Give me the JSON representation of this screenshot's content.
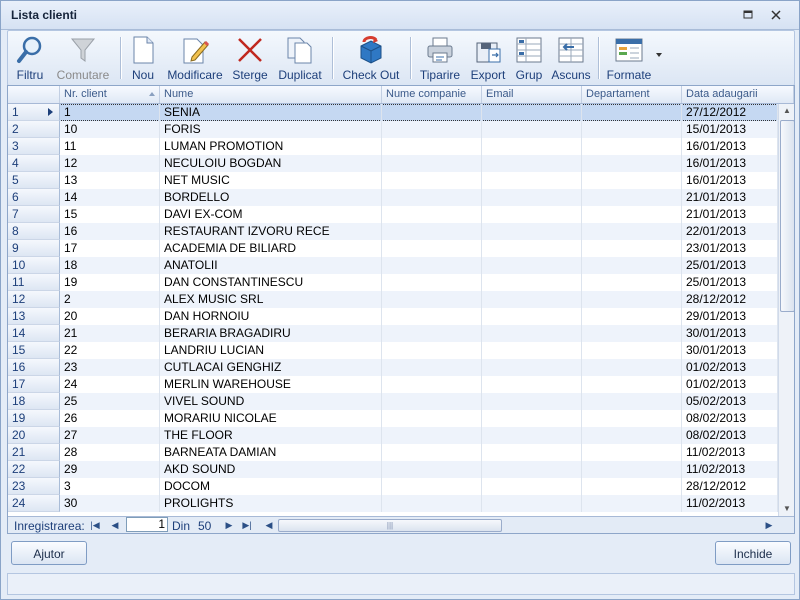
{
  "window": {
    "title": "Lista clienti"
  },
  "toolbar": {
    "filter": "Filtru",
    "toggle": "Comutare",
    "new": "Nou",
    "edit": "Modificare",
    "delete": "Sterge",
    "duplicate": "Duplicat",
    "checkout": "Check Out",
    "print": "Tiparire",
    "export": "Export",
    "group": "Grup",
    "hide": "Ascuns",
    "formats": "Formate"
  },
  "grid": {
    "columns": [
      "Nr. client",
      "Nume",
      "Nume companie",
      "Email",
      "Departament",
      "Data adaugarii"
    ],
    "rows": [
      {
        "n": "1",
        "id": "1",
        "name": "SENIA",
        "date": "27/12/2012"
      },
      {
        "n": "2",
        "id": "10",
        "name": "FORIS",
        "date": "15/01/2013"
      },
      {
        "n": "3",
        "id": "11",
        "name": "LUMAN PROMOTION",
        "date": "16/01/2013"
      },
      {
        "n": "4",
        "id": "12",
        "name": "NECULOIU BOGDAN",
        "date": "16/01/2013"
      },
      {
        "n": "5",
        "id": "13",
        "name": "NET MUSIC",
        "date": "16/01/2013"
      },
      {
        "n": "6",
        "id": "14",
        "name": "BORDELLO",
        "date": "21/01/2013"
      },
      {
        "n": "7",
        "id": "15",
        "name": "DAVI EX-COM",
        "date": "21/01/2013"
      },
      {
        "n": "8",
        "id": "16",
        "name": "RESTAURANT IZVORU RECE",
        "date": "22/01/2013"
      },
      {
        "n": "9",
        "id": "17",
        "name": "ACADEMIA DE BILIARD",
        "date": "23/01/2013"
      },
      {
        "n": "10",
        "id": "18",
        "name": "ANATOLII",
        "date": "25/01/2013"
      },
      {
        "n": "11",
        "id": "19",
        "name": "DAN CONSTANTINESCU",
        "date": "25/01/2013"
      },
      {
        "n": "12",
        "id": "2",
        "name": "ALEX MUSIC SRL",
        "date": "28/12/2012"
      },
      {
        "n": "13",
        "id": "20",
        "name": "DAN HORNOIU",
        "date": "29/01/2013"
      },
      {
        "n": "14",
        "id": "21",
        "name": "BERARIA BRAGADIRU",
        "date": "30/01/2013"
      },
      {
        "n": "15",
        "id": "22",
        "name": "LANDRIU LUCIAN",
        "date": "30/01/2013"
      },
      {
        "n": "16",
        "id": "23",
        "name": "CUTLACAI GENGHIZ",
        "date": "01/02/2013"
      },
      {
        "n": "17",
        "id": "24",
        "name": "MERLIN WAREHOUSE",
        "date": "01/02/2013"
      },
      {
        "n": "18",
        "id": "25",
        "name": "VIVEL SOUND",
        "date": "05/02/2013"
      },
      {
        "n": "19",
        "id": "26",
        "name": "MORARIU NICOLAE",
        "date": "08/02/2013"
      },
      {
        "n": "20",
        "id": "27",
        "name": "THE FLOOR",
        "date": "08/02/2013"
      },
      {
        "n": "21",
        "id": "28",
        "name": "BARNEATA DAMIAN",
        "date": "11/02/2013"
      },
      {
        "n": "22",
        "id": "29",
        "name": "AKD SOUND",
        "date": "11/02/2013"
      },
      {
        "n": "23",
        "id": "3",
        "name": "DOCOM",
        "date": "28/12/2012"
      },
      {
        "n": "24",
        "id": "30",
        "name": "PROLIGHTS",
        "date": "11/02/2013"
      }
    ]
  },
  "navigator": {
    "label": "Inregistrarea:",
    "current": "1",
    "of_label": "Din",
    "total": "50"
  },
  "buttons": {
    "help": "Ajutor",
    "close": "Inchide"
  }
}
